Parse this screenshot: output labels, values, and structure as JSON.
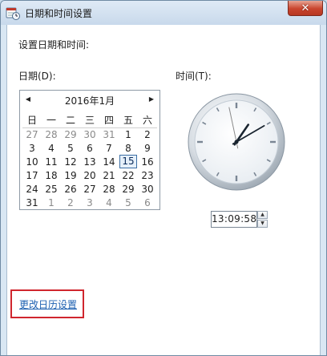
{
  "window": {
    "title": "日期和时间设置",
    "close_label": "✕"
  },
  "main": {
    "heading": "设置日期和时间:",
    "date_label": "日期(D):",
    "time_label": "时间(T):",
    "change_calendar_link": "更改日历设置"
  },
  "calendar": {
    "prev_label": "◀",
    "next_label": "▶",
    "month_title": "2016年1月",
    "weekdays": [
      "日",
      "一",
      "二",
      "三",
      "四",
      "五",
      "六"
    ],
    "weeks": [
      [
        {
          "d": "27",
          "o": true
        },
        {
          "d": "28",
          "o": true
        },
        {
          "d": "29",
          "o": true
        },
        {
          "d": "30",
          "o": true
        },
        {
          "d": "31",
          "o": true
        },
        {
          "d": "1"
        },
        {
          "d": "2"
        }
      ],
      [
        {
          "d": "3"
        },
        {
          "d": "4"
        },
        {
          "d": "5"
        },
        {
          "d": "6"
        },
        {
          "d": "7"
        },
        {
          "d": "8"
        },
        {
          "d": "9"
        }
      ],
      [
        {
          "d": "10"
        },
        {
          "d": "11"
        },
        {
          "d": "12"
        },
        {
          "d": "13"
        },
        {
          "d": "14"
        },
        {
          "d": "15",
          "s": true
        },
        {
          "d": "16"
        }
      ],
      [
        {
          "d": "17"
        },
        {
          "d": "18"
        },
        {
          "d": "19"
        },
        {
          "d": "20"
        },
        {
          "d": "21"
        },
        {
          "d": "22"
        },
        {
          "d": "23"
        }
      ],
      [
        {
          "d": "24"
        },
        {
          "d": "25"
        },
        {
          "d": "26"
        },
        {
          "d": "27"
        },
        {
          "d": "28"
        },
        {
          "d": "29"
        },
        {
          "d": "30"
        }
      ],
      [
        {
          "d": "31"
        },
        {
          "d": "1",
          "o": true
        },
        {
          "d": "2",
          "o": true
        },
        {
          "d": "3",
          "o": true
        },
        {
          "d": "4",
          "o": true
        },
        {
          "d": "5",
          "o": true
        },
        {
          "d": "6",
          "o": true
        }
      ]
    ]
  },
  "clock": {
    "hours": 13,
    "minutes": 9,
    "seconds": 58
  },
  "time": {
    "value": "13:09:58",
    "spin_up": "▲",
    "spin_down": "▼"
  },
  "colors": {
    "link": "#1f62b2",
    "highlight_border": "#d0262e",
    "second_hand": "#8a8a8a",
    "clock_hand": "#1a2530"
  }
}
